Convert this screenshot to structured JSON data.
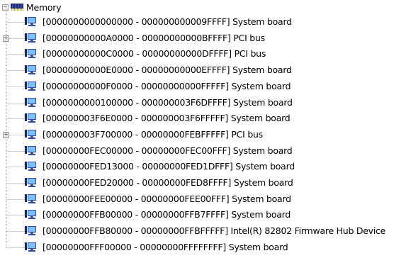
{
  "tree": {
    "root": {
      "label": "Memory",
      "expanded": true,
      "expander_symbol": "−"
    },
    "items": [
      {
        "range": "[0000000000000000 - 000000000009FFFF]",
        "device": "System board",
        "has_children": false
      },
      {
        "range": "[00000000000A0000 - 00000000000BFFFF]",
        "device": "PCI bus",
        "has_children": true
      },
      {
        "range": "[00000000000C0000 - 00000000000DFFFF]",
        "device": "PCI bus",
        "has_children": false
      },
      {
        "range": "[00000000000E0000 - 00000000000EFFFF]",
        "device": "System board",
        "has_children": false
      },
      {
        "range": "[00000000000F0000 - 00000000000FFFFF]",
        "device": "System board",
        "has_children": false
      },
      {
        "range": "[0000000000100000 - 000000003F6DFFFF]",
        "device": "System board",
        "has_children": false
      },
      {
        "range": "[000000003F6E0000 - 000000003F6FFFFF]",
        "device": "System board",
        "has_children": false
      },
      {
        "range": "[000000003F700000 - 00000000FEBFFFFF]",
        "device": "PCI bus",
        "has_children": true
      },
      {
        "range": "[00000000FEC00000 - 00000000FEC00FFF]",
        "device": "System board",
        "has_children": false
      },
      {
        "range": "[00000000FED13000 - 00000000FED1DFFF]",
        "device": "System board",
        "has_children": false
      },
      {
        "range": "[00000000FED20000 - 00000000FED8FFFF]",
        "device": "System board",
        "has_children": false
      },
      {
        "range": "[00000000FEE00000 - 00000000FEE00FFF]",
        "device": "System board",
        "has_children": false
      },
      {
        "range": "[00000000FFB00000 - 00000000FFB7FFFF]",
        "device": "System board",
        "has_children": false
      },
      {
        "range": "[00000000FFB80000 - 00000000FFBFFFFF]",
        "device": "Intel(R) 82802 Firmware Hub Device",
        "has_children": false
      },
      {
        "range": "[00000000FFF00000 - 00000000FFFFFFFF]",
        "device": "System board",
        "has_children": false
      }
    ],
    "collapsed_symbol": "+",
    "colors": {
      "connector": "#a0a0a0",
      "chip_body": "#1a2a6a",
      "chip_pins": "#c8b020",
      "monitor_frame": "#2b4fa8",
      "monitor_screen": "#7fbfff",
      "monitor_base": "#4a5a7a"
    },
    "icons": {
      "root": "memory-chip-icon",
      "item": "memory-resource-icon"
    }
  }
}
